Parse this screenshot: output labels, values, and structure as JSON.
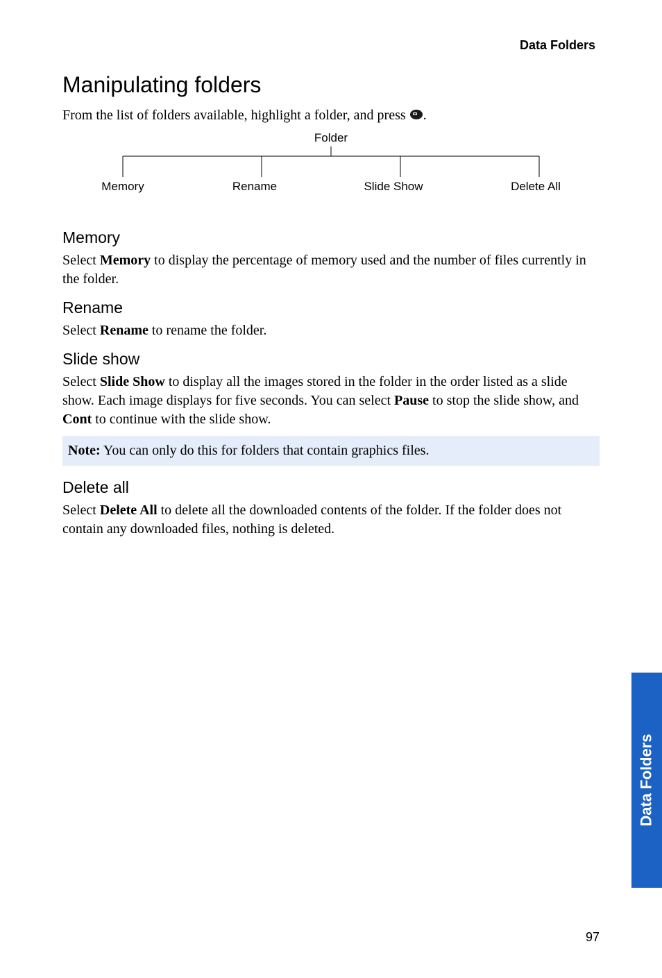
{
  "running_head": "Data Folders",
  "title": "Manipulating folders",
  "intro_prefix": "From the list of folders available, highlight a folder, and press ",
  "intro_suffix": ".",
  "tree": {
    "root": "Folder",
    "leaves": [
      "Memory",
      "Rename",
      "Slide Show",
      "Delete All"
    ]
  },
  "sections": {
    "memory": {
      "heading": "Memory",
      "p1_a": "Select ",
      "p1_bold": "Memory",
      "p1_b": " to display the percentage of memory used and the number of files currently in the folder."
    },
    "rename": {
      "heading": "Rename",
      "p1_a": "Select ",
      "p1_bold": "Rename",
      "p1_b": " to rename the folder."
    },
    "slideshow": {
      "heading": "Slide show",
      "p1_a": "Select ",
      "p1_bold1": "Slide Show",
      "p1_b": " to display all the images stored in the folder in the order listed as a slide show. Each image displays for five seconds. You can select ",
      "p1_bold2": "Pause",
      "p1_c": " to stop the slide show, and ",
      "p1_bold3": "Cont",
      "p1_d": " to continue with the slide show."
    },
    "note": {
      "label": "Note:",
      "text": " You can only do this for folders that contain graphics files."
    },
    "deleteall": {
      "heading": "Delete all",
      "p1_a": "Select ",
      "p1_bold": "Delete All",
      "p1_b": " to delete all the downloaded contents of the folder. If the folder does not contain any downloaded files, nothing is deleted."
    }
  },
  "side_tab": "Data Folders",
  "page_number": "97"
}
